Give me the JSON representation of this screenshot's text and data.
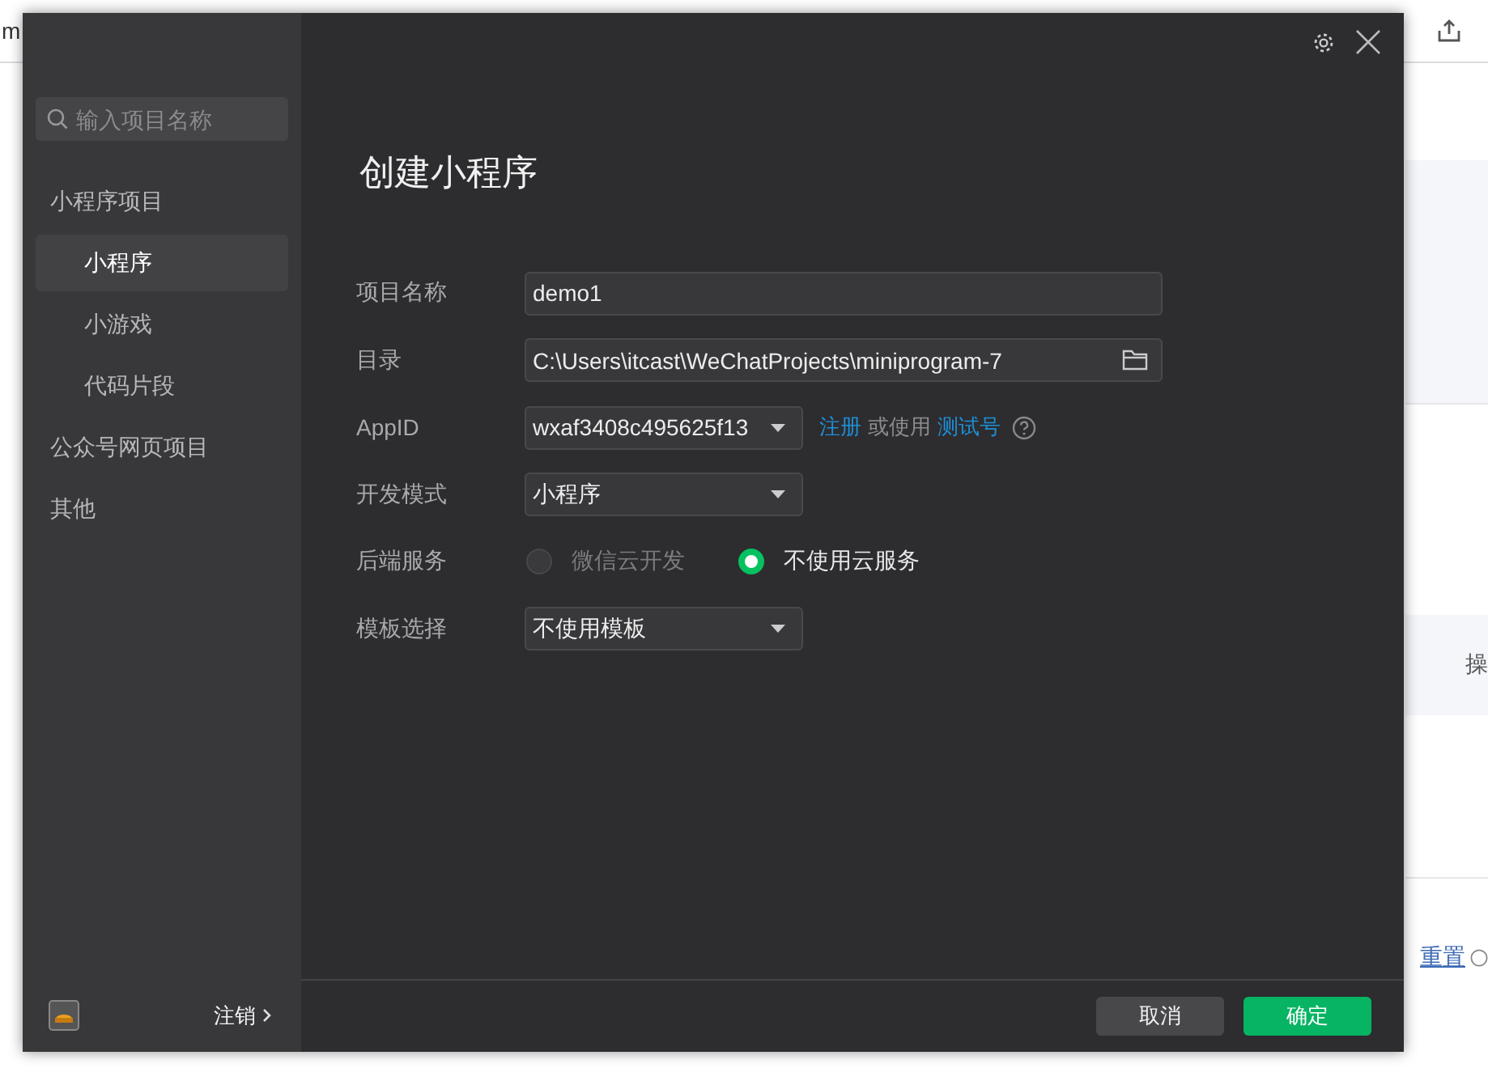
{
  "background_page": {
    "tab_text": "m",
    "column_header": "操",
    "reset_link": "重置"
  },
  "dialog": {
    "title": "创建小程序",
    "sidebar": {
      "search": {
        "placeholder": "输入项目名称"
      },
      "groups": [
        {
          "label": "小程序项目",
          "children": [
            {
              "label": "小程序",
              "selected": true
            },
            {
              "label": "小游戏",
              "selected": false
            },
            {
              "label": "代码片段",
              "selected": false
            }
          ]
        },
        {
          "label": "公众号网页项目"
        },
        {
          "label": "其他"
        }
      ],
      "logout": "注销"
    },
    "form": [
      {
        "kind": "text",
        "label": "项目名称",
        "value": "demo1"
      },
      {
        "kind": "folder",
        "label": "目录",
        "value": "C:\\Users\\itcast\\WeChatProjects\\miniprogram-7"
      },
      {
        "kind": "select",
        "label": "AppID",
        "value": "wxaf3408c495625f13",
        "extras": [
          {
            "kind": "link",
            "text": "注册"
          },
          {
            "kind": "text",
            "text": "或使用"
          },
          {
            "kind": "link",
            "text": "测试号"
          },
          {
            "kind": "help"
          }
        ]
      },
      {
        "kind": "select",
        "label": "开发模式",
        "value": "小程序"
      },
      {
        "kind": "radio",
        "label": "后端服务",
        "options": [
          {
            "label": "微信云开发",
            "selected": false,
            "disabled": true
          },
          {
            "label": "不使用云服务",
            "selected": true,
            "disabled": false
          }
        ]
      },
      {
        "kind": "select",
        "label": "模板选择",
        "value": "不使用模板"
      }
    ],
    "buttons": [
      {
        "label": "取消",
        "kind": "secondary"
      },
      {
        "label": "确定",
        "kind": "primary"
      }
    ]
  }
}
